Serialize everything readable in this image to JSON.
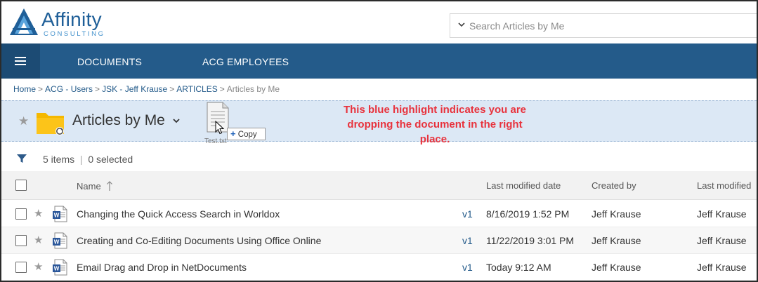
{
  "logo": {
    "name": "Affinity",
    "sub": "CONSULTING"
  },
  "search": {
    "placeholder": "Search Articles by Me"
  },
  "nav": {
    "items": [
      "DOCUMENTS",
      "ACG EMPLOYEES"
    ]
  },
  "breadcrumb": {
    "items": [
      "Home",
      "ACG - Users",
      "JSK - Jeff Krause",
      "ARTICLES"
    ],
    "separator": ">",
    "current": "Articles by Me"
  },
  "folder": {
    "title": "Articles by Me"
  },
  "annotation": {
    "line1": "This blue highlight indicates you are",
    "line2": "dropping the document in the right",
    "line3": "place."
  },
  "drag": {
    "filename": "Test.txt",
    "copy_label": "Copy"
  },
  "filter": {
    "items_count": "5 items",
    "divider": "|",
    "selected_count": "0 selected"
  },
  "table": {
    "columns": {
      "name": "Name",
      "modified": "Last modified date",
      "created_by": "Created by",
      "modified_by": "Last modified"
    },
    "rows": [
      {
        "name": "Changing the Quick Access Search in Worldox",
        "version": "v1",
        "modified": "8/16/2019 1:52 PM",
        "created_by": "Jeff Krause",
        "modified_by": "Jeff Krause"
      },
      {
        "name": "Creating and Co-Editing Documents Using Office Online",
        "version": "v1",
        "modified": "11/22/2019 3:01 PM",
        "created_by": "Jeff Krause",
        "modified_by": "Jeff Krause"
      },
      {
        "name": "Email Drag and Drop in NetDocuments",
        "version": "v1",
        "modified": "Today 9:12 AM",
        "created_by": "Jeff Krause",
        "modified_by": "Jeff Krause"
      }
    ]
  },
  "colors": {
    "brand": "#245b8a",
    "highlight": "#dce8f5",
    "annotation": "#e8323c",
    "folder": "#f5b800",
    "word": "#2b579a"
  }
}
